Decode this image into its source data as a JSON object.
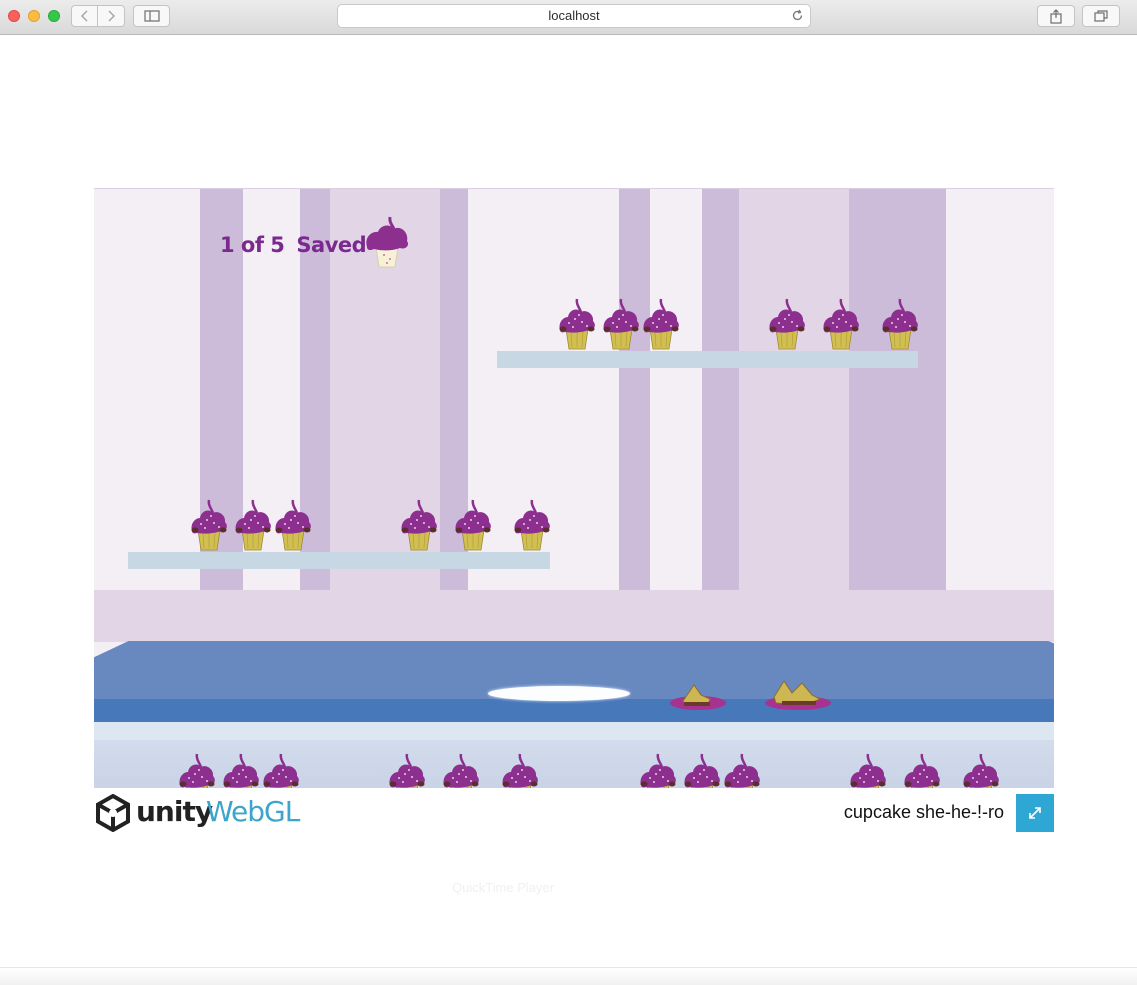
{
  "browser": {
    "url": "localhost",
    "back_icon": "chevron-left-icon",
    "forward_icon": "chevron-right-icon",
    "sidebar_icon": "sidebar-icon",
    "reload_icon": "reload-icon",
    "share_icon": "share-icon",
    "tabs_icon": "tabs-icon"
  },
  "game": {
    "hud": {
      "count": "1 of 5",
      "saved_label": "Saved",
      "icon": "cupcake-icon"
    },
    "colors": {
      "frosting": "#8c2f8f",
      "cake": "#d1bf52",
      "stripe": "#cdbcd9",
      "table": "#6888c0",
      "shelf": "#c8d7e4"
    }
  },
  "footer": {
    "unity_label": "unity",
    "webgl_label": "WebGL",
    "game_title": "cupcake she-he-!-ro",
    "fullscreen_icon": "fullscreen-icon"
  },
  "overlay": {
    "ghost_text": "QuickTime Player"
  }
}
